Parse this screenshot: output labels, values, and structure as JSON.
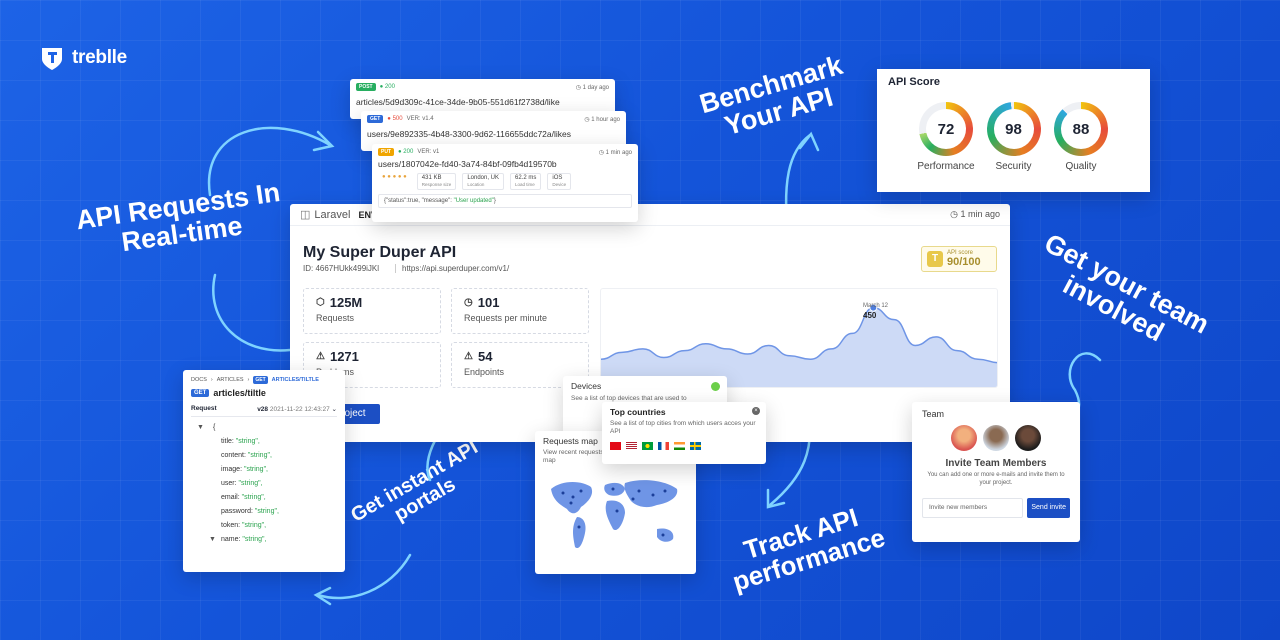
{
  "brand": {
    "name": "treblle",
    "logo_icon": "treblle-logo-icon"
  },
  "headlines": {
    "requests": "API Requests In Real-time",
    "benchmark": "Benchmark Your API",
    "team": "Get your team involved",
    "portals": "Get instant API portals",
    "track": "Track API performance"
  },
  "requests": [
    {
      "method": "POST",
      "status": "200",
      "time": "1 day ago",
      "path": "articles/5d9d309c-41ce-34de-9b05-551d61f2738d/like",
      "colors": {
        "method": "#27ae60",
        "status": "#27ae60"
      }
    },
    {
      "method": "GET",
      "status": "500",
      "version": "VER: v1.4",
      "time": "1 hour ago",
      "path": "users/9e892335-4b48-3300-9d62-116655ddc72a/likes",
      "colors": {
        "method": "#2d6ad8",
        "status": "#e74c3c"
      }
    },
    {
      "method": "PUT",
      "status": "200",
      "version": "VER: v1",
      "time": "1 min ago",
      "path": "users/1807042e-fd40-3a74-84bf-09fb4d19570b",
      "colors": {
        "method": "#f0a500",
        "status": "#27ae60"
      },
      "meta": [
        {
          "value": "431 KB",
          "label": "Response size"
        },
        {
          "value": "London, UK",
          "label": "Location"
        },
        {
          "value": "62.2 ms",
          "label": "Load time"
        },
        {
          "value": "iOS",
          "label": "Device"
        }
      ],
      "body_prefix": "{\"status\":true, \"message\": ",
      "body_str": "\"User updated\"",
      "body_suffix": "}"
    }
  ],
  "dashboard": {
    "framework": "Laravel",
    "env": "ENV",
    "time": "1 min ago",
    "title": "My Super Duper API",
    "id": "ID: 4667HUkk499iJKl",
    "url": "https://api.superduper.com/v1/",
    "score_label": "API score",
    "score_value": "90/100",
    "stats": [
      {
        "value": "125M",
        "label": "Requests",
        "icon": "tag-icon"
      },
      {
        "value": "101",
        "label": "Requests per minute",
        "icon": "clock-icon"
      },
      {
        "value": "1271",
        "label": "Problems",
        "icon": "warning-icon"
      },
      {
        "value": "54",
        "label": "Endpoints",
        "icon": "warning-icon"
      }
    ],
    "tooltip_date": "March 12",
    "tooltip_value": "450",
    "button": "oject"
  },
  "chart_data": {
    "type": "area",
    "values": [
      150,
      190,
      210,
      160,
      200,
      240,
      210,
      180,
      230,
      170,
      150,
      210,
      300,
      450,
      380,
      230,
      280,
      200,
      150,
      130
    ],
    "highlight_index": 13,
    "color": "#6f95e6"
  },
  "api_score": {
    "title": "API Score",
    "gauges": [
      {
        "value": "72",
        "label": "Performance"
      },
      {
        "value": "98",
        "label": "Security"
      },
      {
        "value": "88",
        "label": "Quality"
      }
    ]
  },
  "team": {
    "title": "Team",
    "heading": "Invite Team Members",
    "text": "You can add one or more e-mails and invite them to your project.",
    "input_placeholder": "Invite new members",
    "button": "Send invite"
  },
  "portal": {
    "crumb_docs": "DOCS",
    "crumb_articles": "ARTICLES",
    "crumb_method": "GET",
    "crumb_endpoint": "ARTICLES/TILTLE",
    "method": "GET",
    "title": "articles/tiltle",
    "section": "Request",
    "version": "v28",
    "date": "2021-11-22 12:43:27",
    "fields": [
      {
        "key": "title: ",
        "val": "\"string\","
      },
      {
        "key": "content: ",
        "val": "\"string\","
      },
      {
        "key": "image: ",
        "val": "\"string\","
      },
      {
        "key": "user: ",
        "val": "\"string\","
      },
      {
        "key": "email: ",
        "val": "\"string\","
      },
      {
        "key": "password: ",
        "val": "\"string\","
      },
      {
        "key": "token: ",
        "val": "\"string\","
      },
      {
        "key": "name: ",
        "val": "\"string\","
      }
    ]
  },
  "devices": {
    "title": "Devices",
    "text": "See a list of top devices that are used to"
  },
  "countries": {
    "title": "Top countries",
    "text": "See a list of top cities from which users acces your API"
  },
  "map": {
    "title": "Requests map",
    "text": "View recent requests your API directly on a live map"
  }
}
